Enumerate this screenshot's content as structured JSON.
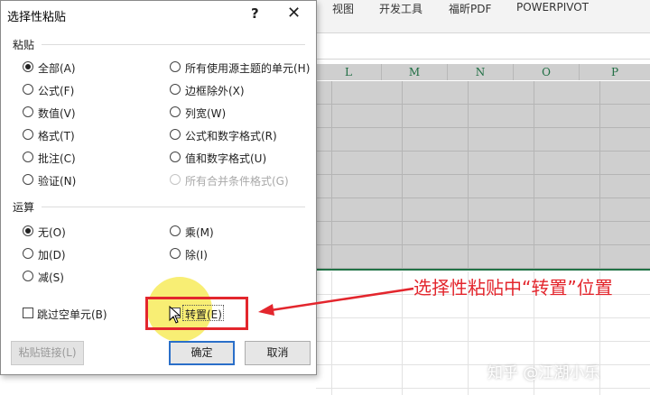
{
  "ribbon": {
    "tabs": [
      "视图",
      "开发工具",
      "福昕PDF",
      "POWERPIVOT"
    ]
  },
  "sheet": {
    "columns": [
      "L",
      "M",
      "N",
      "O",
      "P"
    ]
  },
  "dialog": {
    "title": "选择性粘贴",
    "help": "?",
    "close": "✕",
    "paste_label": "粘贴",
    "paste_options_left": [
      {
        "label": "全部(A)",
        "selected": true
      },
      {
        "label": "公式(F)",
        "selected": false
      },
      {
        "label": "数值(V)",
        "selected": false
      },
      {
        "label": "格式(T)",
        "selected": false
      },
      {
        "label": "批注(C)",
        "selected": false
      },
      {
        "label": "验证(N)",
        "selected": false
      }
    ],
    "paste_options_right": [
      {
        "label": "所有使用源主题的单元(H)",
        "enabled": true
      },
      {
        "label": "边框除外(X)",
        "enabled": true
      },
      {
        "label": "列宽(W)",
        "enabled": true
      },
      {
        "label": "公式和数字格式(R)",
        "enabled": true
      },
      {
        "label": "值和数字格式(U)",
        "enabled": true
      },
      {
        "label": "所有合并条件格式(G)",
        "enabled": false
      }
    ],
    "operation_label": "运算",
    "operation_left": [
      {
        "label": "无(O)",
        "selected": true
      },
      {
        "label": "加(D)",
        "selected": false
      },
      {
        "label": "减(S)",
        "selected": false
      }
    ],
    "operation_right": [
      {
        "label": "乘(M)",
        "selected": false
      },
      {
        "label": "除(I)",
        "selected": false
      }
    ],
    "skip_blanks": "跳过空单元(B)",
    "transpose": "转置(E)",
    "paste_link": "粘贴链接(L)",
    "ok": "确定",
    "cancel": "取消"
  },
  "annotation": "选择性粘贴中“转置”位置",
  "watermark": "知乎 @江湖小乐",
  "colors": {
    "accent_red": "#e3262d",
    "highlight": "#f6e846",
    "default_button_border": "#2a6fc9"
  }
}
